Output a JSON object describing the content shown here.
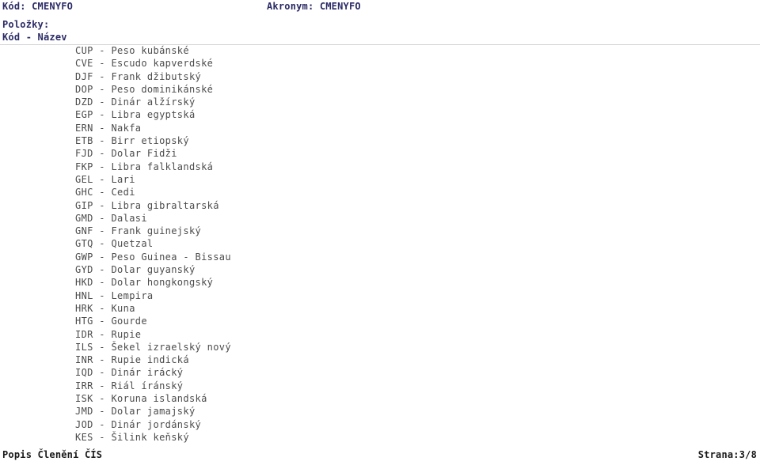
{
  "header": {
    "code_label": "Kód:",
    "code_value": "CMENYFO",
    "code_line": "Kód: CMENYFO",
    "acronym_label": "Akronym:",
    "acronym_value": "CMENYFO",
    "acronym_line": "Akronym: CMENYFO",
    "items_label": "Položky:",
    "columns_header": "Kód - Název"
  },
  "items": [
    {
      "code": "CUP",
      "sep": " - ",
      "name": "Peso kubánské",
      "line": "CUP - Peso kubánské"
    },
    {
      "code": "CVE",
      "sep": " - ",
      "name": "Escudo kapverdské",
      "line": "CVE - Escudo kapverdské"
    },
    {
      "code": "DJF",
      "sep": " - ",
      "name": "Frank džibutský",
      "line": "DJF - Frank džibutský"
    },
    {
      "code": "DOP",
      "sep": " - ",
      "name": "Peso dominikánské",
      "line": "DOP - Peso dominikánské"
    },
    {
      "code": "DZD",
      "sep": " - ",
      "name": "Dinár alžírský",
      "line": "DZD - Dinár alžírský"
    },
    {
      "code": "EGP",
      "sep": " - ",
      "name": "Libra egyptská",
      "line": "EGP - Libra egyptská"
    },
    {
      "code": "ERN",
      "sep": " - ",
      "name": "Nakfa",
      "line": "ERN - Nakfa"
    },
    {
      "code": "ETB",
      "sep": " - ",
      "name": "Birr etiopský",
      "line": "ETB - Birr etiopský"
    },
    {
      "code": "FJD",
      "sep": " - ",
      "name": "Dolar Fidži",
      "line": "FJD - Dolar Fidži"
    },
    {
      "code": "FKP",
      "sep": " - ",
      "name": "Libra falklandská",
      "line": "FKP - Libra falklandská"
    },
    {
      "code": "GEL",
      "sep": " - ",
      "name": "Lari",
      "line": "GEL - Lari"
    },
    {
      "code": "GHC",
      "sep": " - ",
      "name": "Cedi",
      "line": "GHC - Cedi"
    },
    {
      "code": "GIP",
      "sep": " - ",
      "name": "Libra gibraltarská",
      "line": "GIP - Libra gibraltarská"
    },
    {
      "code": "GMD",
      "sep": " - ",
      "name": "Dalasi",
      "line": "GMD - Dalasi"
    },
    {
      "code": "GNF",
      "sep": " - ",
      "name": "Frank guinejský",
      "line": "GNF - Frank guinejský"
    },
    {
      "code": "GTQ",
      "sep": " - ",
      "name": "Quetzal",
      "line": "GTQ - Quetzal"
    },
    {
      "code": "GWP",
      "sep": " - ",
      "name": "Peso Guinea - Bissau",
      "line": "GWP - Peso Guinea - Bissau"
    },
    {
      "code": "GYD",
      "sep": " - ",
      "name": "Dolar guyanský",
      "line": "GYD - Dolar guyanský"
    },
    {
      "code": "HKD",
      "sep": " - ",
      "name": "Dolar hongkongský",
      "line": "HKD - Dolar hongkongský"
    },
    {
      "code": "HNL",
      "sep": " - ",
      "name": "Lempira",
      "line": "HNL - Lempira"
    },
    {
      "code": "HRK",
      "sep": " - ",
      "name": "Kuna",
      "line": "HRK - Kuna"
    },
    {
      "code": "HTG",
      "sep": " - ",
      "name": "Gourde",
      "line": "HTG - Gourde"
    },
    {
      "code": "IDR",
      "sep": " - ",
      "name": "Rupie",
      "line": "IDR - Rupie"
    },
    {
      "code": "ILS",
      "sep": " - ",
      "name": "Šekel izraelský nový",
      "line": "ILS - Šekel izraelský nový"
    },
    {
      "code": "INR",
      "sep": " - ",
      "name": "Rupie indická",
      "line": "INR - Rupie indická"
    },
    {
      "code": "IQD",
      "sep": " - ",
      "name": "Dinár irácký",
      "line": "IQD - Dinár irácký"
    },
    {
      "code": "IRR",
      "sep": " - ",
      "name": "Riál íránský",
      "line": "IRR - Riál íránský"
    },
    {
      "code": "ISK",
      "sep": " - ",
      "name": "Koruna islandská",
      "line": "ISK - Koruna islandská"
    },
    {
      "code": "JMD",
      "sep": " - ",
      "name": "Dolar jamajský",
      "line": "JMD - Dolar jamajský"
    },
    {
      "code": "JOD",
      "sep": " - ",
      "name": "Dinár jordánský",
      "line": "JOD - Dinár jordánský"
    },
    {
      "code": "KES",
      "sep": " - ",
      "name": "Šilink keňský",
      "line": "KES - Šilink keňský"
    }
  ],
  "footer": {
    "title": "Popis Členění ČÍS",
    "page_label": "Strana:",
    "page_value": "3/8",
    "page_text": "Strana:3/8"
  },
  "colors": {
    "header_text": "#2b2b66",
    "body_text": "#4c4c4c",
    "footer_text": "#1a1a1a",
    "rule": "#d3d3d3",
    "background": "#ffffff"
  }
}
